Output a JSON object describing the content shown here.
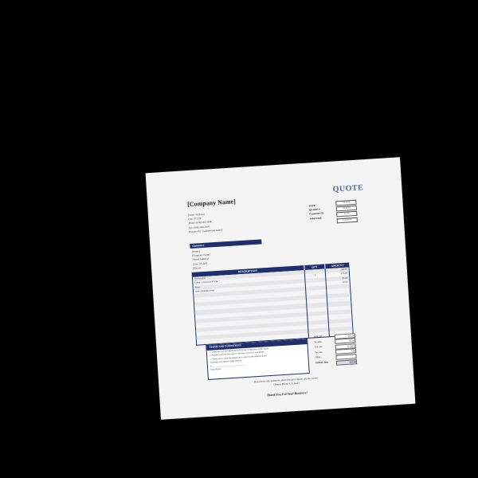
{
  "document": {
    "company_name": "[Company Name]",
    "title": "QUOTE",
    "address": [
      "[Street Address]",
      "City, ST ZIP",
      "Phone: (000) 000-0000",
      "Fax: (000) 000-0000",
      "Prepared by: [salesperson name]"
    ],
    "meta_labels": [
      "DATE",
      "QUOTE #",
      "Customer ID",
      "Valid Until"
    ],
    "meta_values": [
      "1/1/2016",
      "[123456]",
      "[123]",
      "1/31/2016"
    ],
    "customer_header": "Customer",
    "customer_lines": [
      "[Name]",
      "[Company Name]",
      "[Street Address]",
      "[City, ST ZIP]",
      "[Phone]"
    ],
    "columns": [
      "DESCRIPTION",
      "QTY",
      "AMOUNT"
    ],
    "items": [
      {
        "desc": "Service Fee",
        "qty": "",
        "amt": "200.00"
      },
      {
        "desc": "Labor: 5 hours at $75/hr",
        "qty": "5",
        "amt": "375.00"
      },
      {
        "desc": "Parts",
        "qty": "",
        "amt": "95.00"
      },
      {
        "desc": "New client discount",
        "qty": "",
        "amt": "-50.00"
      },
      {
        "desc": "",
        "qty": "",
        "amt": ""
      },
      {
        "desc": "",
        "qty": "",
        "amt": ""
      },
      {
        "desc": "",
        "qty": "",
        "amt": ""
      },
      {
        "desc": "",
        "qty": "",
        "amt": ""
      },
      {
        "desc": "",
        "qty": "",
        "amt": ""
      },
      {
        "desc": "",
        "qty": "",
        "amt": ""
      },
      {
        "desc": "",
        "qty": "",
        "amt": ""
      },
      {
        "desc": "",
        "qty": "",
        "amt": ""
      },
      {
        "desc": "",
        "qty": "",
        "amt": ""
      },
      {
        "desc": "",
        "qty": "",
        "amt": ""
      },
      {
        "desc": "",
        "qty": "",
        "amt": ""
      },
      {
        "desc": "",
        "qty": "",
        "amt": ""
      }
    ],
    "totals": [
      {
        "label": "Subtotal",
        "value": "620.00"
      },
      {
        "label": "Taxable",
        "value": "95.00"
      },
      {
        "label": "Tax rate",
        "value": "6.250%"
      },
      {
        "label": "Tax due",
        "value": "5.94"
      },
      {
        "label": "Other",
        "value": "-"
      },
      {
        "label": "TOTAL Due",
        "value": "625.94"
      }
    ],
    "terms_header": "TERMS AND CONDITIONS",
    "terms_lines": [
      "1. Customer will be billed after indicating acceptance of this quote",
      "2. Payment will be due prior to delivery of service and goods",
      "3. Please fax or mail the signed price quote to the address above",
      "Customer Acceptance (sign below):",
      "X ______________________________",
      "Print Name:"
    ],
    "footer_line1": "If you have any questions about this price quote, please contact",
    "footer_line2": "[Name, Phone #, E-mail]",
    "thanks": "Thank You For Your Business!"
  }
}
